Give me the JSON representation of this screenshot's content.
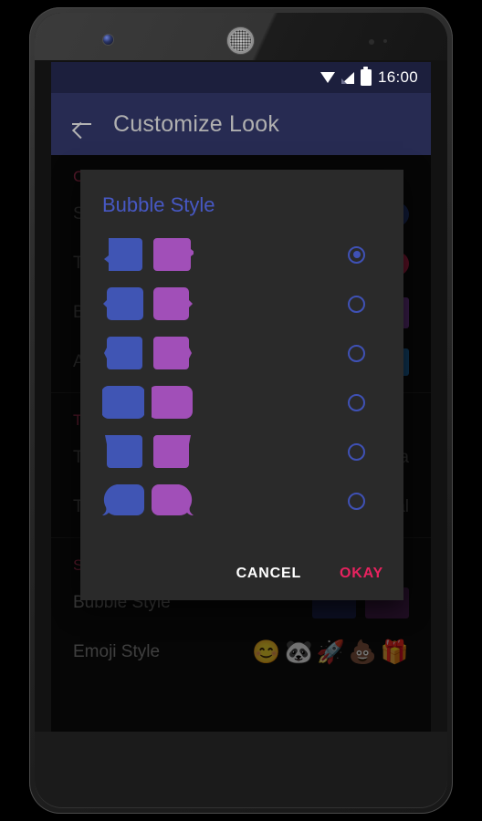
{
  "device": {
    "camera_icon": "front-camera",
    "speaker_icon": "earpiece-speaker",
    "sensor_icon": "proximity-sensor"
  },
  "statusbar": {
    "wifi_icon": "wifi-icon",
    "signal_icon": "cell-signal-icon",
    "battery_icon": "battery-icon",
    "clock": "16:00",
    "background": "#1c1f3d"
  },
  "appbar": {
    "back_icon": "back-arrow-icon",
    "title": "Customize Look",
    "background": "#272b52",
    "title_color": "#b0b0b0"
  },
  "settings": {
    "sections": [
      {
        "header": "Colors",
        "rows": [
          {
            "label": "Sent Message Color",
            "accessory": "swatch",
            "color": "#253a7a"
          },
          {
            "label": "Theme Color",
            "accessory": "swatch",
            "color": "#c1244f"
          },
          {
            "label": "Background Color",
            "accessory": "bubble",
            "color": "#7b3f9d"
          },
          {
            "label": "Accent Color",
            "accessory": "swatch",
            "color": "#1f6fb0"
          }
        ]
      },
      {
        "header": "Text",
        "rows": [
          {
            "label": "Text Size",
            "accessory": "value",
            "value": "Media"
          },
          {
            "label": "Text Font",
            "accessory": "value",
            "value": "Normal"
          }
        ]
      },
      {
        "header": "Styles",
        "rows": [
          {
            "label": "Bubble Style",
            "accessory": "mini-bubbles"
          },
          {
            "label": "Emoji Style",
            "accessory": "emoji"
          }
        ]
      }
    ],
    "section_header_color": "#b9365c",
    "emoji_preview": [
      "😊",
      "🐼",
      "🚀",
      "💩",
      "🎁"
    ],
    "mini_bubble_colors": [
      "#1e2550",
      "#47204f"
    ]
  },
  "dialog": {
    "title": "Bubble Style",
    "title_color": "#4758c4",
    "background": "#2a2a2a",
    "bubble_colors": {
      "sent": "#4055b4",
      "received": "#a14fb8"
    },
    "radio_color": "#3f51b5",
    "options": [
      {
        "name": "notched-flat",
        "selected": true
      },
      {
        "name": "rounded-tail",
        "selected": false
      },
      {
        "name": "bracket-notch",
        "selected": false
      },
      {
        "name": "rounded-plain",
        "selected": false
      },
      {
        "name": "square-top-tail",
        "selected": false
      },
      {
        "name": "oval-tail",
        "selected": false
      }
    ],
    "buttons": {
      "cancel": "CANCEL",
      "okay": "OKAY",
      "cancel_color": "#ffffff",
      "okay_color": "#e8225f"
    }
  }
}
